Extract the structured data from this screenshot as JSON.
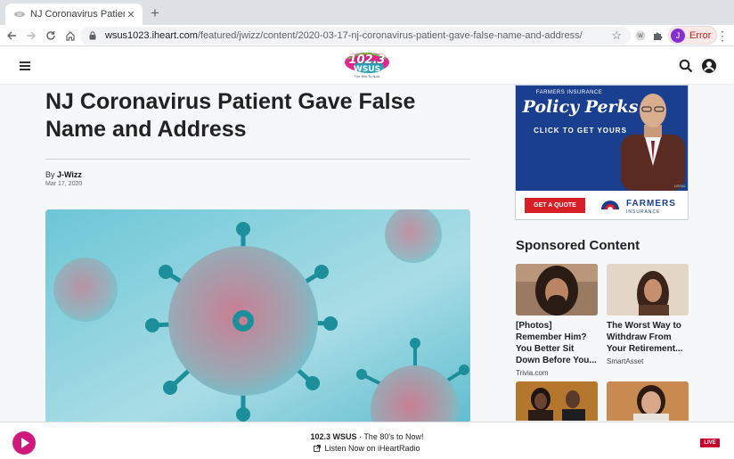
{
  "browser": {
    "tab_title": "NJ Coronavirus Patient Gave F",
    "tab_close": "✕",
    "new_tab": "+",
    "url_host": "wsus1023.iheart.com",
    "url_path": "/featured/jwizz/content/2020-03-17-nj-coronavirus-patient-gave-false-name-and-address/",
    "profile_initial": "J",
    "profile_label": "Error",
    "icons": [
      "back-icon",
      "forward-icon",
      "reload-icon",
      "home-icon",
      "lock-icon",
      "star-icon",
      "extension-icon",
      "puzzle-icon",
      "menu-kebab-icon"
    ]
  },
  "site": {
    "logo_number": "102.3",
    "logo_call": "WSUS",
    "logo_tagline": "The 80s To Now"
  },
  "article": {
    "headline": "NJ Coronavirus Patient Gave False Name and Address",
    "byline_prefix": "By ",
    "author": "J-Wizz",
    "date": "Mar 17, 2020"
  },
  "ad": {
    "brand_line": "FARMERS INSURANCE",
    "headline": "Policy Perks",
    "cta": "CLICK TO GET YOURS",
    "legal": "LEGAL",
    "quote_button": "GET A QUOTE",
    "brand": "FARMERS",
    "brand_sub": "INSURANCE",
    "colors": {
      "primary": "#1b3f8f",
      "accent": "#d81e27"
    }
  },
  "sponsored": {
    "title": "Sponsored Content",
    "cards": [
      {
        "title": "[Photos] Remember Him? You Better Sit Down Before You...",
        "source": "Trivia.com"
      },
      {
        "title": "The Worst Way to Withdraw From Your Retirement...",
        "source": "SmartAsset"
      }
    ]
  },
  "player": {
    "station": "102.3 WSUS",
    "separator": " · ",
    "slogan": "The 80's to Now!",
    "listen": "Listen Now on iHeartRadio",
    "live": "LIVE",
    "accent": "#d1197d"
  }
}
